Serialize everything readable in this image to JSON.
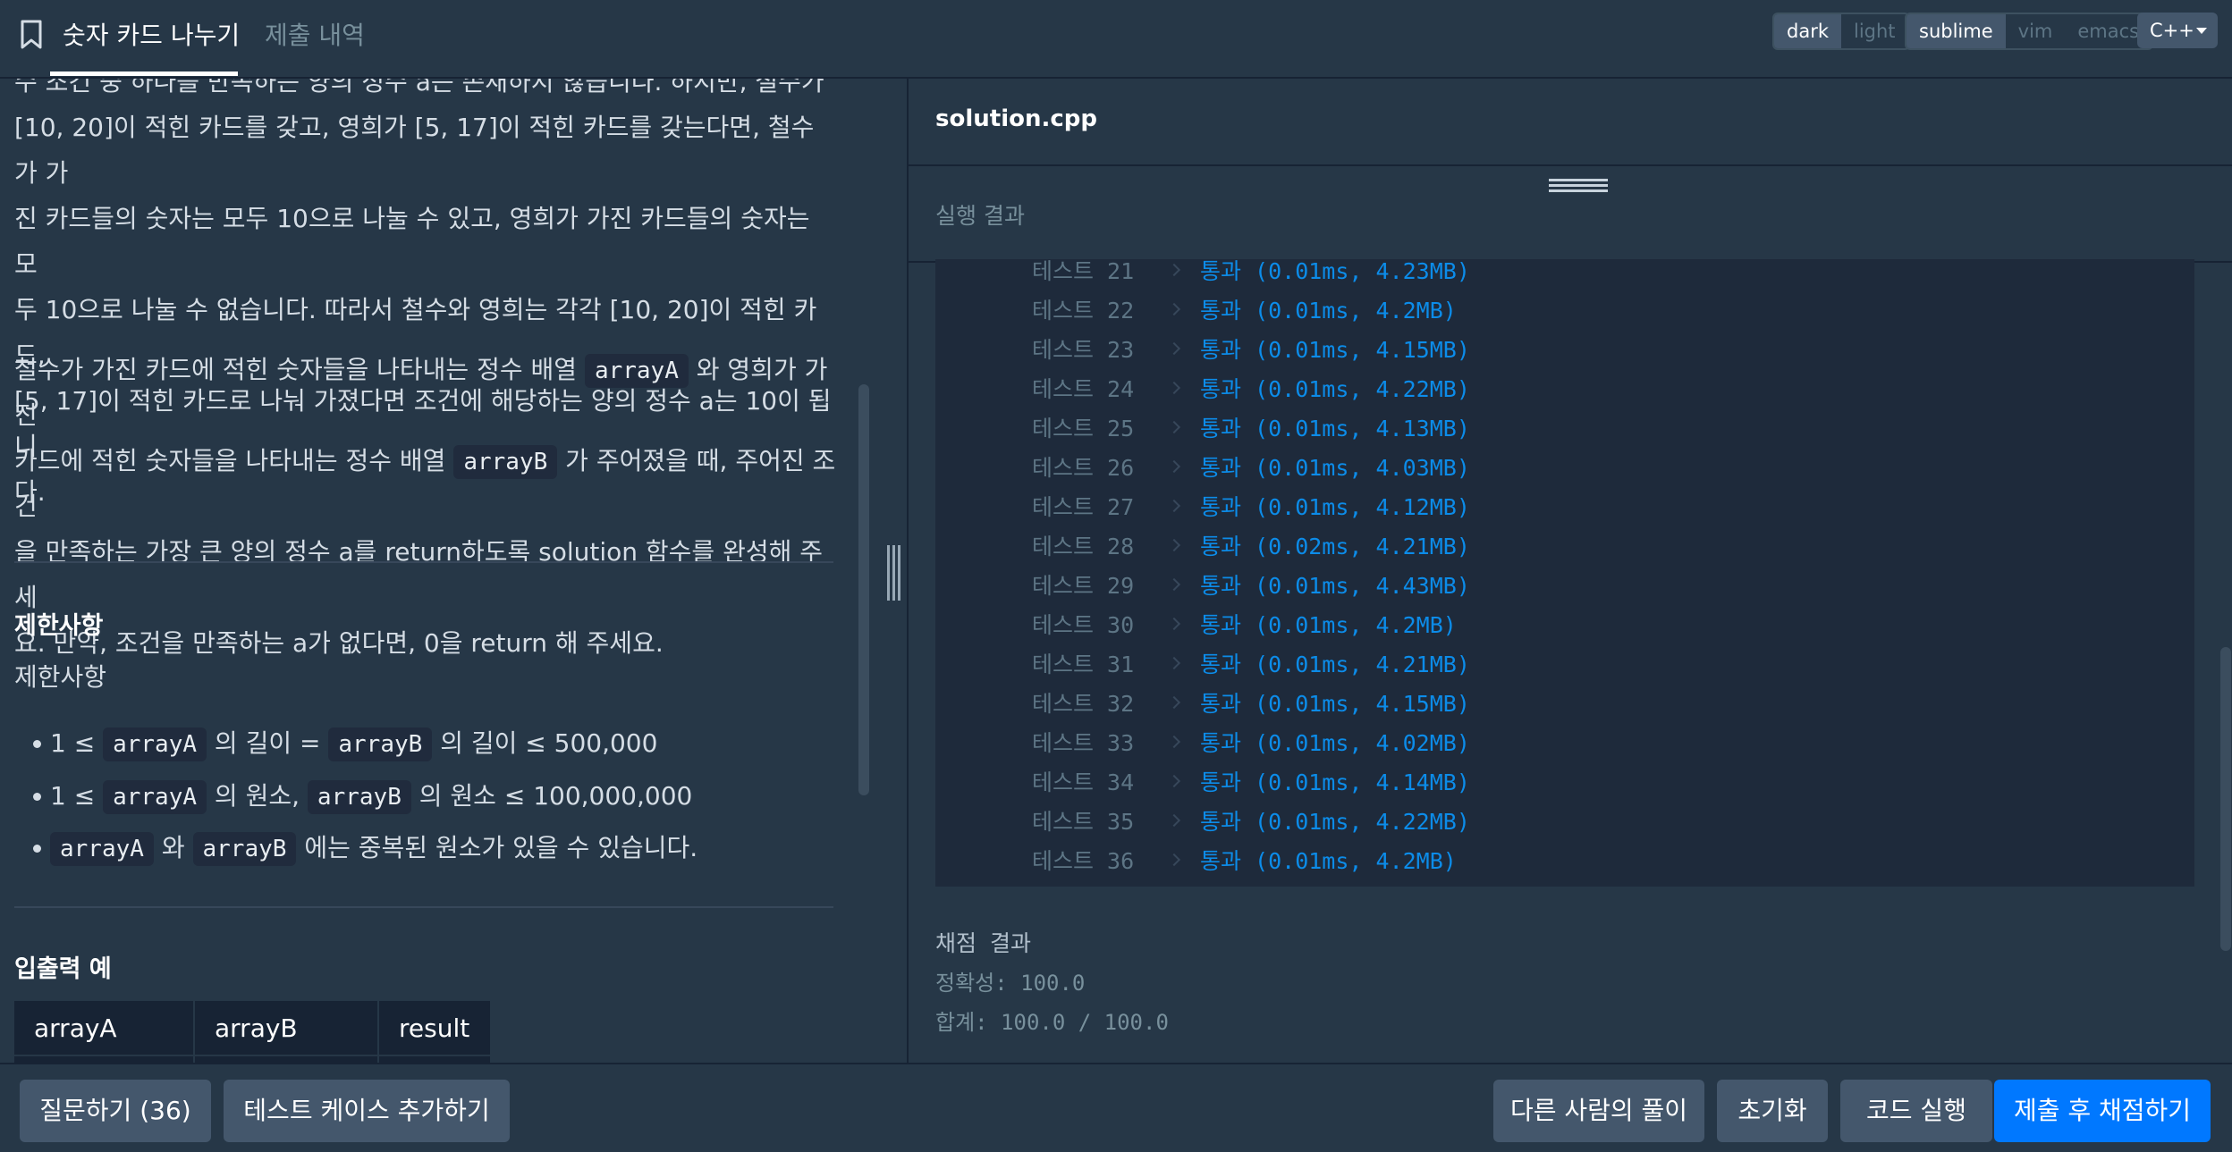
{
  "header": {
    "tab_problem": "숫자 카드 나누기",
    "tab_submissions": "제출 내역",
    "theme_options": [
      "dark",
      "light"
    ],
    "keymap_options": [
      "sublime",
      "vim",
      "emacs"
    ],
    "language": "C++"
  },
  "description": {
    "paragraph1_lines": [
      "수 조건 중 하나를 만족하는 양의 정수 a는 존재하지 않습니다. 하지만, 철수가",
      "[10, 20]이 적힌 카드를 갖고, 영희가 [5, 17]이 적힌 카드를 갖는다면, 철수가 가",
      "진 카드들의 숫자는 모두 10으로 나눌 수 있고, 영희가 가진 카드들의 숫자는 모",
      "두 10으로 나눌 수 없습니다. 따라서 철수와 영희는 각각 [10, 20]이 적힌 카드,",
      "[5, 17]이 적힌 카드로 나눠 가졌다면 조건에 해당하는 양의 정수 a는 10이 됩니",
      "다."
    ],
    "p2_l1_a": "철수가 가진 카드에 적힌 숫자들을 나타내는 정수 배열",
    "p2_l1_code": "arrayA",
    "p2_l1_b": "와 영희가 가진",
    "p2_l2_a": "카드에 적힌 숫자들을 나타내는 정수 배열",
    "p2_l2_code": "arrayB",
    "p2_l2_b": "가 주어졌을 때, 주어진 조건",
    "p2_l3": "을 만족하는 가장 큰 양의 정수 a를 return하도록 solution 함수를 완성해 주세",
    "p2_l4": "요. 만약, 조건을 만족하는 a가 없다면, 0을 return 해 주세요.",
    "constraints_heading": "제한사항",
    "constraints_sub": "제한사항",
    "c1_a": "1 ≤",
    "c1_code1": "arrayA",
    "c1_b": "의 길이 =",
    "c1_code2": "arrayB",
    "c1_c": "의 길이 ≤ 500,000",
    "c2_a": "1 ≤",
    "c2_code1": "arrayA",
    "c2_b": "의 원소,",
    "c2_code2": "arrayB",
    "c2_c": "의 원소 ≤ 100,000,000",
    "c3_code1": "arrayA",
    "c3_a": "와",
    "c3_code2": "arrayB",
    "c3_b": "에는 중복된 원소가 있을 수 있습니다.",
    "io_heading": "입출력 예",
    "io_columns": [
      "arrayA",
      "arrayB",
      "result"
    ]
  },
  "editor": {
    "filename": "solution.cpp"
  },
  "results": {
    "label": "실행 결과",
    "tests": [
      {
        "label": "테스트 21",
        "result": "통과 (0.01ms, 4.23MB)"
      },
      {
        "label": "테스트 22",
        "result": "통과 (0.01ms, 4.2MB)"
      },
      {
        "label": "테스트 23",
        "result": "통과 (0.01ms, 4.15MB)"
      },
      {
        "label": "테스트 24",
        "result": "통과 (0.01ms, 4.22MB)"
      },
      {
        "label": "테스트 25",
        "result": "통과 (0.01ms, 4.13MB)"
      },
      {
        "label": "테스트 26",
        "result": "통과 (0.01ms, 4.03MB)"
      },
      {
        "label": "테스트 27",
        "result": "통과 (0.01ms, 4.12MB)"
      },
      {
        "label": "테스트 28",
        "result": "통과 (0.02ms, 4.21MB)"
      },
      {
        "label": "테스트 29",
        "result": "통과 (0.01ms, 4.43MB)"
      },
      {
        "label": "테스트 30",
        "result": "통과 (0.01ms, 4.2MB)"
      },
      {
        "label": "테스트 31",
        "result": "통과 (0.01ms, 4.21MB)"
      },
      {
        "label": "테스트 32",
        "result": "통과 (0.01ms, 4.15MB)"
      },
      {
        "label": "테스트 33",
        "result": "통과 (0.01ms, 4.02MB)"
      },
      {
        "label": "테스트 34",
        "result": "통과 (0.01ms, 4.14MB)"
      },
      {
        "label": "테스트 35",
        "result": "통과 (0.01ms, 4.22MB)"
      },
      {
        "label": "테스트 36",
        "result": "통과 (0.01ms, 4.2MB)"
      }
    ],
    "score_title": "채점 결과",
    "accuracy": "정확성: 100.0",
    "total": "합계: 100.0 / 100.0"
  },
  "footer": {
    "question_button": "질문하기 (36)",
    "add_testcase_button": "테스트 케이스 추가하기",
    "others_solutions_button": "다른 사람의 풀이",
    "reset_button": "초기화",
    "run_button": "코드 실행",
    "submit_button": "제출 후 채점하기"
  },
  "colors": {
    "background": "#263747",
    "console_bg": "#1e2a3b",
    "pass_blue": "#0c8ce9",
    "submit_blue": "#0078ff"
  }
}
